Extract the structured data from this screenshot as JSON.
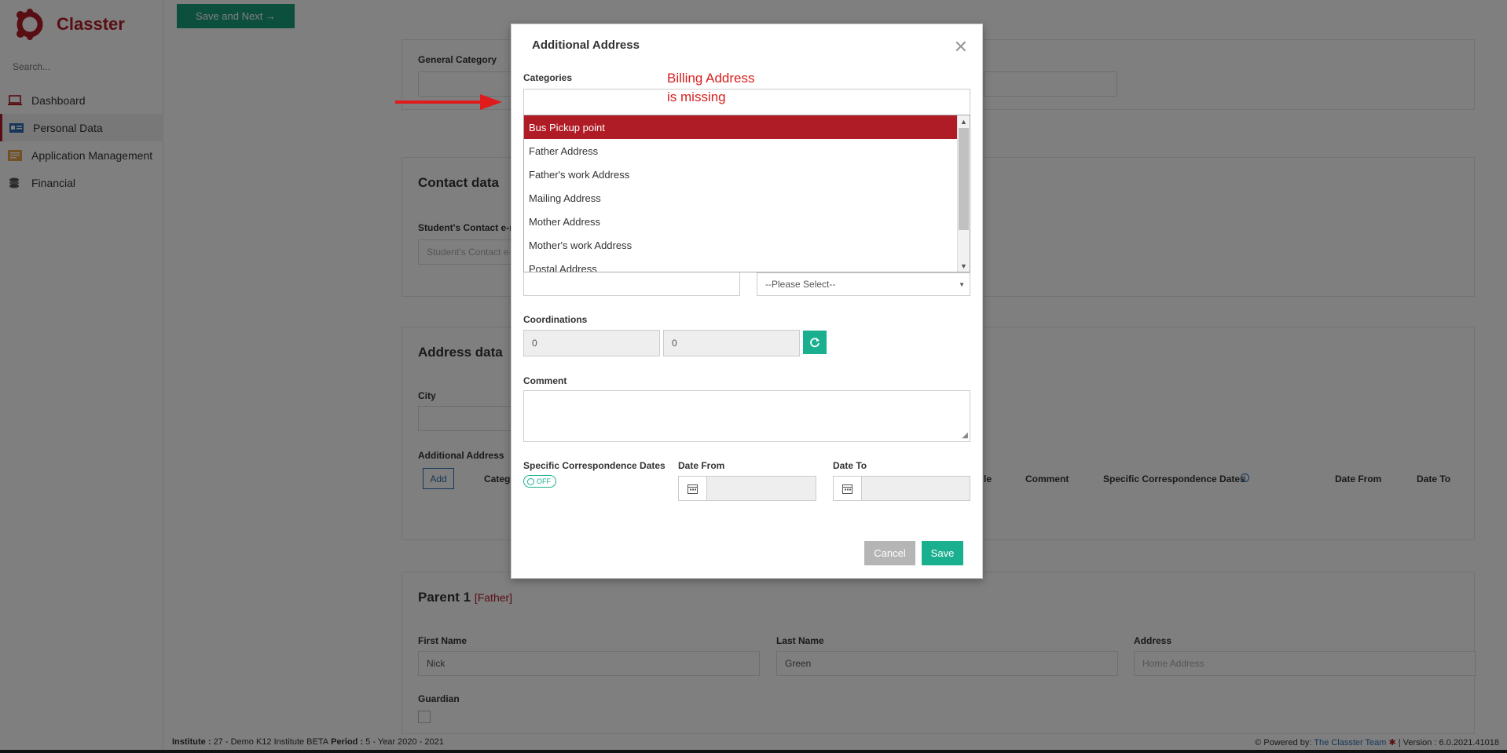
{
  "app": {
    "name": "Classter",
    "brand_color": "#b01c26",
    "accent_color": "#1aaf8f"
  },
  "sidebar": {
    "search_placeholder": "Search...",
    "items": [
      {
        "label": "Dashboard",
        "icon": "laptop-icon"
      },
      {
        "label": "Personal Data",
        "icon": "id-card-icon"
      },
      {
        "label": "Application Management",
        "icon": "folder-icon"
      },
      {
        "label": "Financial",
        "icon": "coins-icon"
      }
    ]
  },
  "toolbar": {
    "save_next_label": "Save and Next →"
  },
  "page": {
    "general_category_label": "General Category",
    "contact": {
      "title": "Contact data",
      "email_label": "Student's Contact e-m",
      "email_placeholder": "Student's Contact e-m"
    },
    "address": {
      "title": "Address data",
      "city_label": "City",
      "additional_label": "Additional Address",
      "add_button": "Add",
      "columns": [
        "Catego",
        "le",
        "Comment",
        "Specific Correspondence Dates",
        "Date From",
        "Date To"
      ]
    },
    "parent": {
      "title": "Parent 1",
      "relation": "[Father]",
      "first_name_label": "First Name",
      "first_name": "Nick",
      "last_name_label": "Last Name",
      "last_name": "Green",
      "address_label": "Address",
      "address_placeholder": "Home Address",
      "guardian_label": "Guardian"
    }
  },
  "modal": {
    "title": "Additional Address",
    "categories_label": "Categories",
    "category_options": [
      "Bus Pickup point",
      "Father Address",
      "Father's work Address",
      "Mailing Address",
      "Mother Address",
      "Mother's work Address",
      "Postal Address"
    ],
    "selected_option": "Bus Pickup point",
    "please_select": "--Please Select--",
    "coordinations_label": "Coordinations",
    "lat": "0",
    "lng": "0",
    "comment_label": "Comment",
    "specific_dates_label": "Specific Correspondence Dates",
    "toggle_label": "OFF",
    "date_from_label": "Date From",
    "date_to_label": "Date To",
    "cancel_label": "Cancel",
    "save_label": "Save"
  },
  "annotation": {
    "line1": "Billing Address",
    "line2": "is missing"
  },
  "footer": {
    "institute_label": "Institute :",
    "institute_value": "27 - Demo K12 Institute BETA",
    "period_label": "Period :",
    "period_value": "5 - Year 2020 - 2021",
    "powered_by": "Powered by:",
    "team_link": "The Classter Team",
    "version": "| Version : 6.0.2021.41018"
  }
}
